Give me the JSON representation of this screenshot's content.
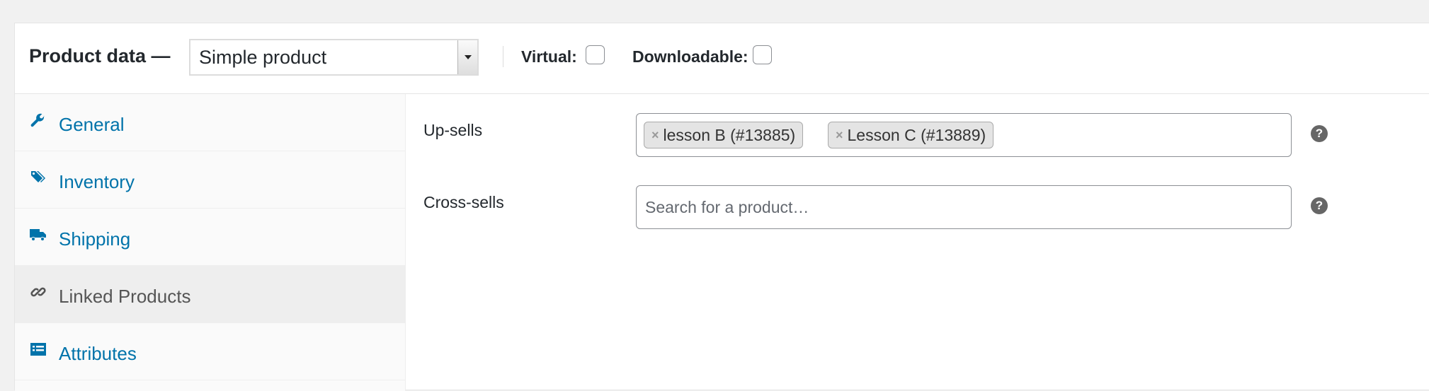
{
  "header": {
    "title": "Product data —",
    "product_type": {
      "selected": "Simple product"
    },
    "options": [
      {
        "label": "Virtual:",
        "checked": false
      },
      {
        "label": "Downloadable:",
        "checked": false
      }
    ]
  },
  "tabs": [
    {
      "label": "General",
      "icon": "wrench-icon",
      "active": false
    },
    {
      "label": "Inventory",
      "icon": "tag-icon",
      "active": false
    },
    {
      "label": "Shipping",
      "icon": "truck-icon",
      "active": false
    },
    {
      "label": "Linked Products",
      "icon": "link-icon",
      "active": true
    },
    {
      "label": "Attributes",
      "icon": "list-icon",
      "active": false
    }
  ],
  "linked_products": {
    "upsells": {
      "label": "Up-sells",
      "selected": [
        {
          "label": "lesson B (#13885)",
          "remove": "×"
        },
        {
          "label": "Lesson C (#13889)",
          "remove": "×"
        }
      ],
      "help": "?"
    },
    "crosssells": {
      "label": "Cross-sells",
      "placeholder": "Search for a product…",
      "help": "?"
    }
  },
  "colors": {
    "link": "#0073aa",
    "active_tab_bg": "#eeeeee",
    "sidebar_bg": "#fafafa"
  }
}
